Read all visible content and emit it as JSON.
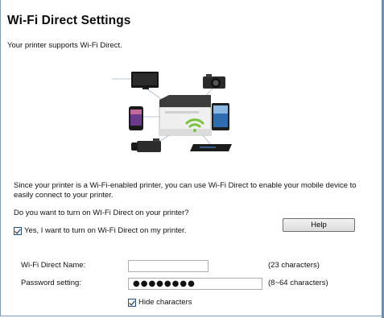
{
  "header": {
    "title": "Wi-Fi Direct Settings",
    "subtitle": "Your printer supports Wi-Fi Direct."
  },
  "info": {
    "description": "Since your printer is a Wi-Fi-enabled printer, you can use Wi-Fi Direct to enable your mobile device to easily connect to your printer.",
    "question": "Do you want to turn on WI-Fi Direct on your printer?"
  },
  "enable_checkbox": {
    "label": "Yes, I want to turn on Wi-Fi Direct on my printer.",
    "checked": true
  },
  "help_button": {
    "label": "Help"
  },
  "form": {
    "name_label": "Wi-Fi Direct Name:",
    "name_value": "",
    "name_hint": "(23 characters)",
    "password_label": "Password setting:",
    "password_value": "●●●●●●●●",
    "password_hint": "(8~64 characters)"
  },
  "hide_checkbox": {
    "label": "Hide characters",
    "checked": true
  },
  "illustration": {
    "icons": [
      "monitor-icon",
      "camera-icon",
      "smartphone-icon",
      "printer-icon",
      "tablet-icon",
      "wifi-icon",
      "camcorder-icon",
      "media-player-icon"
    ],
    "wifi_color": "#7cc242"
  }
}
